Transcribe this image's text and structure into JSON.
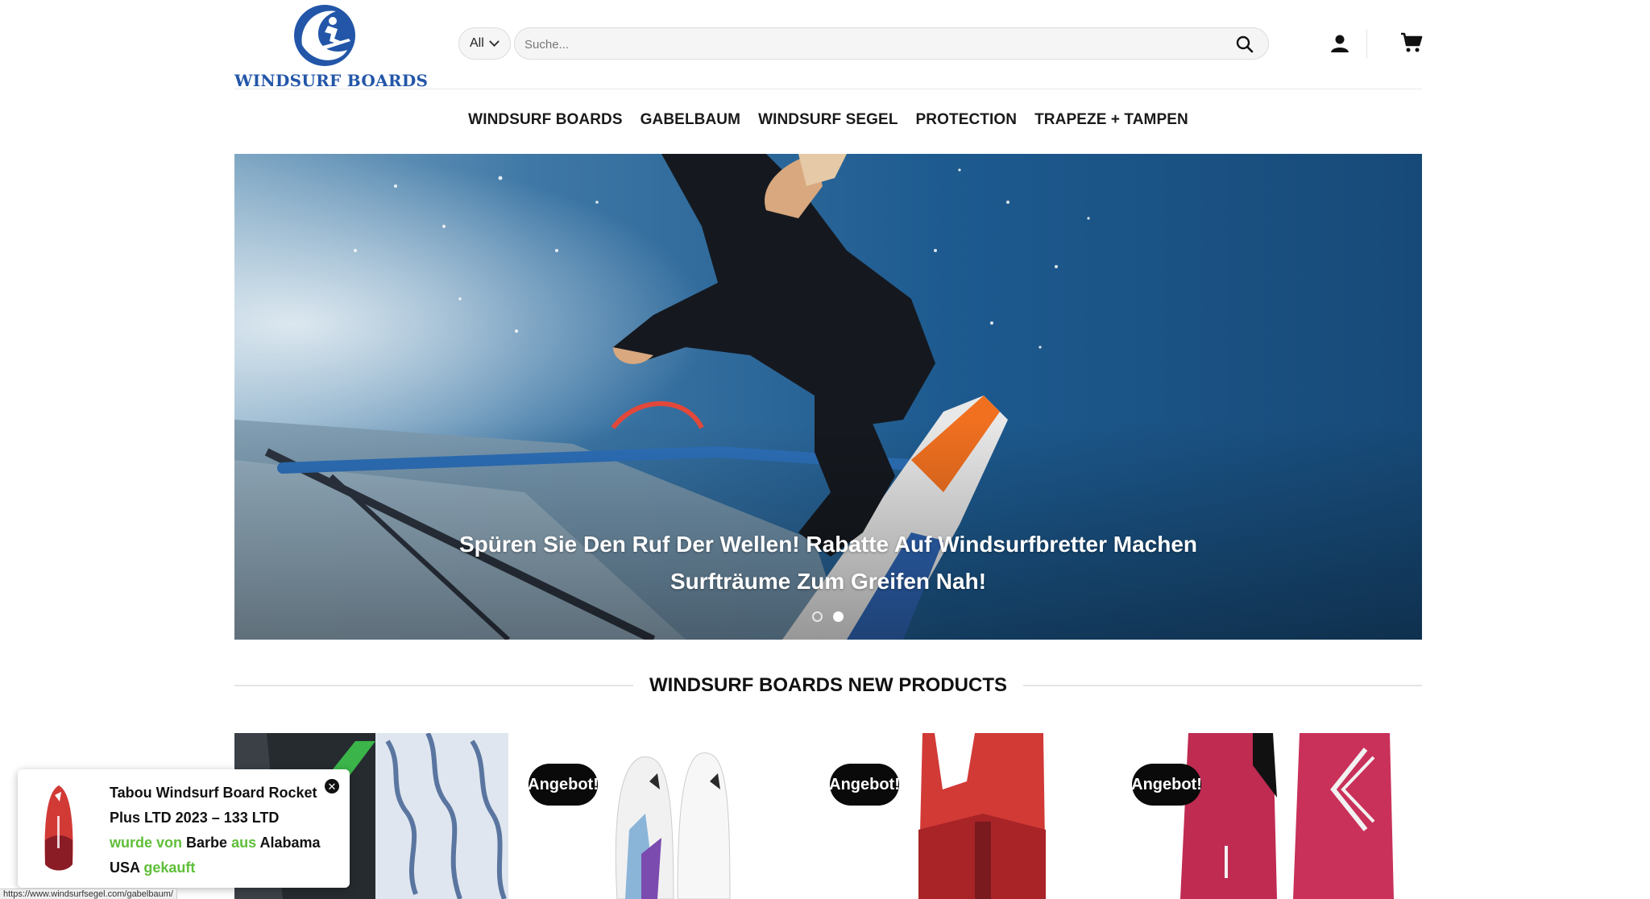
{
  "brand": {
    "logo_text": "WINDSURF BOARDS",
    "logo_color": "#2356a8"
  },
  "search": {
    "category": "All",
    "placeholder": "Suche..."
  },
  "nav": {
    "items": [
      {
        "label": "WINDSURF BOARDS"
      },
      {
        "label": "GABELBAUM"
      },
      {
        "label": "WINDSURF SEGEL"
      },
      {
        "label": "PROTECTION"
      },
      {
        "label": "TRAPEZE + TAMPEN"
      }
    ]
  },
  "hero": {
    "caption_line1": "Spüren Sie Den Ruf Der Wellen! Rabatte Auf Windsurfbretter Machen",
    "caption_line2": "Surfträume Zum Greifen Nah!",
    "slides": 2,
    "active_slide": 2
  },
  "section": {
    "title": "WINDSURF BOARDS NEW PRODUCTS"
  },
  "products": [
    {
      "badge": ""
    },
    {
      "badge": "Angebot!"
    },
    {
      "badge": "Angebot!"
    },
    {
      "badge": "Angebot!"
    }
  ],
  "toast": {
    "product": "Tabou Windsurf Board Rocket Plus LTD 2023 – 133 LTD",
    "text_bought_by": "wurde von",
    "buyer": "Barbe",
    "text_from": "aus",
    "location": "Alabama USA",
    "text_bought": "gekauft",
    "accent_color": "#5fbf3a"
  },
  "status_bar": {
    "url": "https://www.windsurfsegel.com/gabelbaum/"
  }
}
